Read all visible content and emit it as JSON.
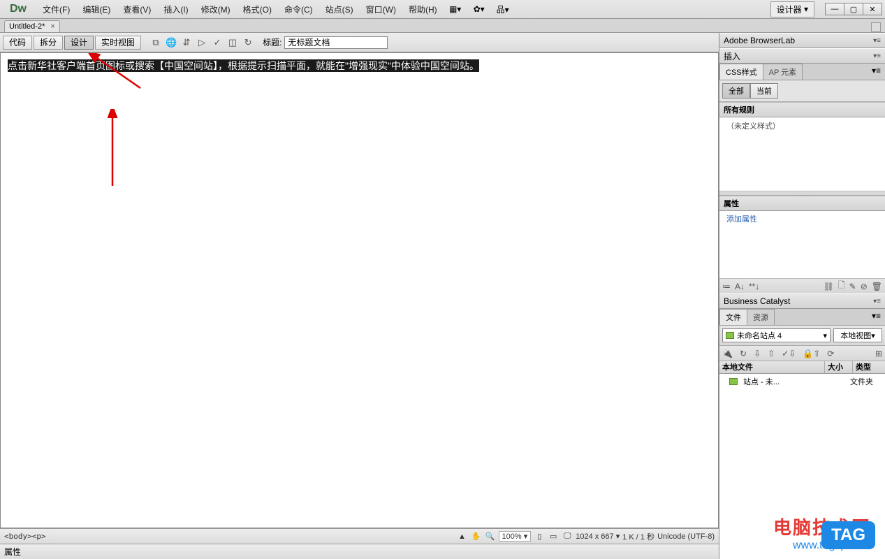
{
  "app": {
    "logo": "Dw",
    "layout_label": "设计器"
  },
  "menus": [
    "文件(F)",
    "编辑(E)",
    "查看(V)",
    "插入(I)",
    "修改(M)",
    "格式(O)",
    "命令(C)",
    "站点(S)",
    "窗口(W)",
    "帮助(H)"
  ],
  "tab": {
    "name": "Untitled-2*"
  },
  "view_buttons": {
    "code": "代码",
    "split": "拆分",
    "design": "设计",
    "live": "实时视图"
  },
  "title": {
    "label": "标题:",
    "value": "无标题文档"
  },
  "document_text": "点击新华社客户端首页图标或搜索【中国空间站】，根据提示扫描平面，就能在\"增强现实\"中体验中国空间站。",
  "status": {
    "tag_path": "<body><p>",
    "zoom": "100%",
    "dims": "1024 x 667",
    "size_time": "1 K / 1 秒",
    "encoding": "Unicode (UTF-8)"
  },
  "props_panel_label": "属性",
  "panels": {
    "browserlab": "Adobe BrowserLab",
    "insert": "插入",
    "css_tab": "CSS样式",
    "ap_tab": "AP 元素",
    "all": "全部",
    "current": "当前",
    "all_rules": "所有规则",
    "no_styles": "（未定义样式）",
    "properties": "属性",
    "add_prop": "添加属性",
    "biz": "Business Catalyst",
    "files_tab": "文件",
    "assets_tab": "资源",
    "site_name": "未命名站点 4",
    "view_mode": "本地视图",
    "col_file": "本地文件",
    "col_size": "大小",
    "col_type": "类型",
    "tree_item": "站点 - 未...",
    "tree_type": "文件夹"
  },
  "watermark": {
    "line1": "电脑技术网",
    "line2": "www.tagxp.com",
    "badge": "TAG"
  }
}
